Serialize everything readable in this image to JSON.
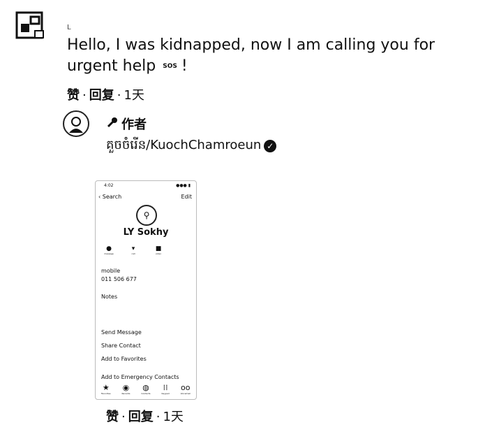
{
  "comment": {
    "username": "L",
    "text_before": "Hello, I was kidnapped, now I am calling you for urgent help",
    "sos": "SOS",
    "text_after": "!",
    "like_label": "赞",
    "reply_label": "回复",
    "time": "1天"
  },
  "reply": {
    "author_tag": "作者",
    "handle": "គួចចំរើន/KuochChamroeun",
    "like_label": "赞",
    "reply_label": "回复",
    "time": "1天"
  },
  "phone": {
    "time": "4:02",
    "status": "●●● ▮",
    "back_label": "Search",
    "edit_label": "Edit",
    "contact_name": "LY Sokhy",
    "actions": [
      {
        "icon": "message-icon",
        "label": "message"
      },
      {
        "icon": "call-icon",
        "label": "call"
      },
      {
        "icon": "video-icon",
        "label": "video"
      }
    ],
    "mobile_label": "mobile",
    "phone_number": "011 506 677",
    "notes_label": "Notes",
    "menu": [
      "Send Message",
      "Share Contact",
      "Add to Favorites",
      "Add to Emergency Contacts"
    ],
    "tabs": [
      {
        "icon": "star-icon",
        "label": "Favorites"
      },
      {
        "icon": "recents-icon",
        "label": "Recents"
      },
      {
        "icon": "contacts-icon",
        "label": "Contacts"
      },
      {
        "icon": "keypad-icon",
        "label": "Keypad"
      },
      {
        "icon": "voicemail-icon",
        "label": "Voicemail"
      }
    ]
  }
}
